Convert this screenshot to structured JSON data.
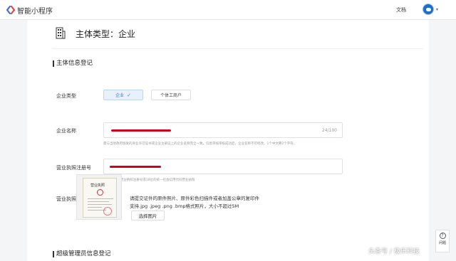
{
  "header": {
    "brand": "智能小程序",
    "doc_link": "文档",
    "user_caret": "▾"
  },
  "page": {
    "title": "主体类型：企业"
  },
  "section_subject": {
    "title": "主体信息登记"
  },
  "company_type": {
    "label": "企业类型",
    "options": [
      "企业",
      "个体工商户"
    ],
    "selected": "企业",
    "check": "✓"
  },
  "company_name": {
    "label": "企业名称",
    "counter": "24/100",
    "hint": "需与当地政府颁发的商业许可证书或企业注册证上的企业名称完全一致，信息审核审核成功后，企业名称不可修改。1个中文算2个字符。"
  },
  "license_number": {
    "label": "营业执照注册号",
    "hint": "请输入15位营业执照注册号或18位的统一社会信用代码营业执照"
  },
  "license_photo": {
    "label": "营业执照",
    "thumb_title": "营业执照",
    "line1": "请提交证件的原件照片、原件彩色扫描件或者加盖公章的复印件",
    "line2": "支持.jpg .jpeg .png .bmp格式照片，大小不超过5M",
    "button": "选择图片"
  },
  "section_admin": {
    "title": "超级管理员信息登记"
  },
  "help": {
    "icon": "?",
    "label": "问题"
  },
  "watermark": "头条号 / 极乐科技",
  "colors": {
    "accent": "#3a78d8",
    "redaction": "#d0021b",
    "logo_blue": "#3a6fd8",
    "logo_red": "#e0463c"
  }
}
